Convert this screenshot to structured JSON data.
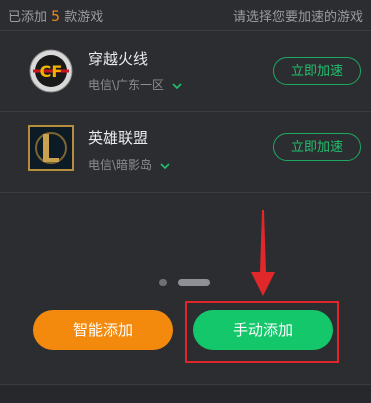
{
  "header": {
    "added_prefix": "已添加",
    "added_count": "5",
    "added_suffix": "款游戏",
    "hint": "请选择您要加速的游戏"
  },
  "games": [
    {
      "name": "穿越火线",
      "server": "电信\\广东一区",
      "icon": "crossfire-logo-icon",
      "action_label": "立即加速"
    },
    {
      "name": "英雄联盟",
      "server": "电信\\暗影岛",
      "icon": "league-of-legends-logo-icon",
      "action_label": "立即加速"
    }
  ],
  "pagination": {
    "pages": 2,
    "current": 2
  },
  "actions": {
    "smart_add_label": "智能添加",
    "manual_add_label": "手动添加"
  },
  "colors": {
    "accent_green": "#15c76b",
    "accent_orange": "#f38a0d",
    "annotation_red": "#e0282a",
    "background": "#2b2d31"
  }
}
